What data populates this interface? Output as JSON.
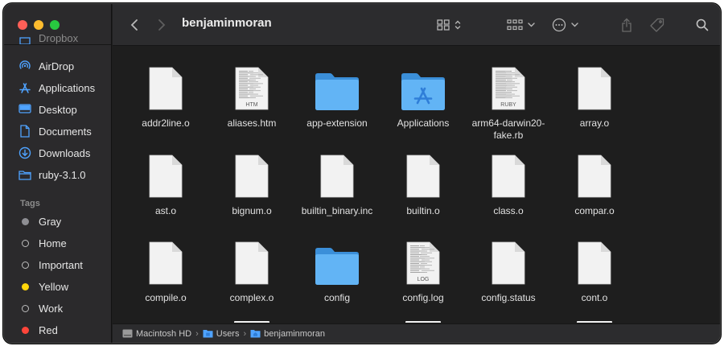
{
  "window": {
    "title": "benjaminmoran"
  },
  "sidebar": {
    "partial_item": "Dropbox",
    "items": [
      {
        "label": "AirDrop",
        "icon": "airdrop-icon"
      },
      {
        "label": "Applications",
        "icon": "applications-icon"
      },
      {
        "label": "Desktop",
        "icon": "desktop-icon"
      },
      {
        "label": "Documents",
        "icon": "document-icon"
      },
      {
        "label": "Downloads",
        "icon": "downloads-icon"
      },
      {
        "label": "ruby-3.1.0",
        "icon": "folder-icon"
      }
    ],
    "tags_header": "Tags",
    "tags": [
      {
        "label": "Gray",
        "color": "#8e8e93"
      },
      {
        "label": "Home",
        "color": ""
      },
      {
        "label": "Important",
        "color": ""
      },
      {
        "label": "Yellow",
        "color": "#ffd60a"
      },
      {
        "label": "Work",
        "color": ""
      },
      {
        "label": "Red",
        "color": "#ff453a"
      }
    ]
  },
  "files": [
    {
      "name": "addr2line.o",
      "kind": "doc"
    },
    {
      "name": "aliases.htm",
      "kind": "text",
      "badge": "HTM"
    },
    {
      "name": "app-extension",
      "kind": "folder"
    },
    {
      "name": "Applications",
      "kind": "apps-folder"
    },
    {
      "name": "arm64-darwin20-fake.rb",
      "kind": "text",
      "badge": "RUBY"
    },
    {
      "name": "array.o",
      "kind": "doc"
    },
    {
      "name": "ast.o",
      "kind": "doc"
    },
    {
      "name": "bignum.o",
      "kind": "doc"
    },
    {
      "name": "builtin_binary.inc",
      "kind": "doc"
    },
    {
      "name": "builtin.o",
      "kind": "doc"
    },
    {
      "name": "class.o",
      "kind": "doc"
    },
    {
      "name": "compar.o",
      "kind": "doc"
    },
    {
      "name": "compile.o",
      "kind": "doc"
    },
    {
      "name": "complex.o",
      "kind": "doc"
    },
    {
      "name": "config",
      "kind": "folder"
    },
    {
      "name": "config.log",
      "kind": "text",
      "badge": "LOG"
    },
    {
      "name": "config.status",
      "kind": "doc"
    },
    {
      "name": "cont.o",
      "kind": "doc"
    }
  ],
  "pathbar": {
    "crumbs": [
      {
        "label": "Macintosh HD",
        "icon": "hard-drive-icon"
      },
      {
        "label": "Users",
        "icon": "folder-icon"
      },
      {
        "label": "benjaminmoran",
        "icon": "folder-icon"
      }
    ],
    "separator": "›"
  }
}
